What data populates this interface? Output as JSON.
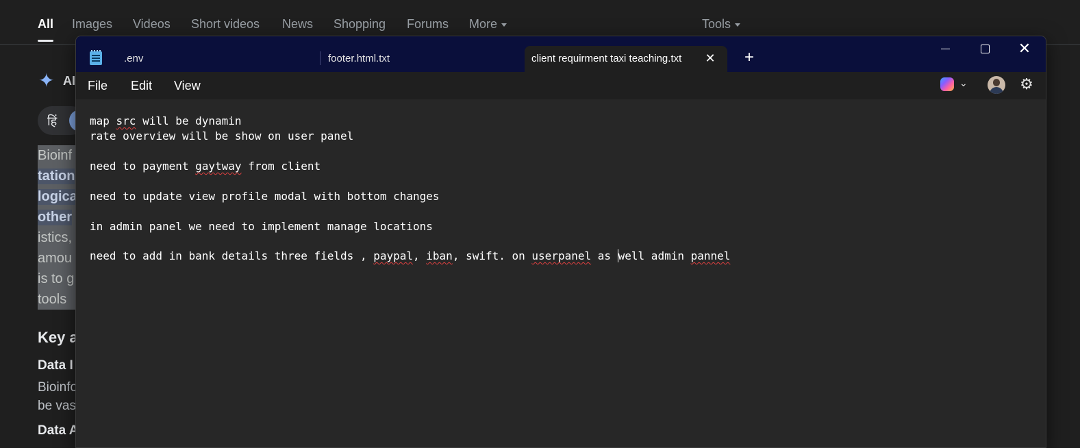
{
  "search": {
    "tabs": [
      "All",
      "Images",
      "Videos",
      "Short videos",
      "News",
      "Shopping",
      "Forums",
      "More"
    ],
    "tools": "Tools"
  },
  "background": {
    "ai_label": "AI",
    "lang_pill": "हिं",
    "lines": [
      "Bioinf",
      "tation",
      "logica",
      "other",
      "istics,",
      "amou",
      "is to g",
      "tools"
    ],
    "heading": "Key a",
    "sub1": "Data I",
    "text1": "Bioinfo",
    "text2": "be vas",
    "sub2": "Data A"
  },
  "window": {
    "tabs": [
      {
        "label": ".env"
      },
      {
        "label": "footer.html.txt"
      },
      {
        "label": "client requirment taxi teaching.txt"
      }
    ],
    "menu": [
      "File",
      "Edit",
      "View"
    ],
    "icons": {
      "app": "notepad-icon",
      "copilot": "copilot-icon",
      "settings": "gear-icon",
      "minimize": "minimize-icon",
      "maximize": "maximize-icon",
      "close": "close-icon"
    }
  },
  "editor": {
    "line1": {
      "a": "map ",
      "b": "src",
      "c": " will be dynamin"
    },
    "line2": "rate overview will be show on user panel",
    "line4": {
      "a": "need to payment ",
      "b": "gaytway",
      "c": " from client"
    },
    "line6": "need to update view profile modal with bottom changes",
    "line8": "in admin panel we need to implement manage locations",
    "line10": {
      "a": "need to add in bank details three fields , ",
      "b": "paypal",
      "c": ", ",
      "d": "iban",
      "e": ", swift. on ",
      "f": "userpanel",
      "g": " as ",
      "h": "well admin ",
      "i": "pannel"
    }
  }
}
